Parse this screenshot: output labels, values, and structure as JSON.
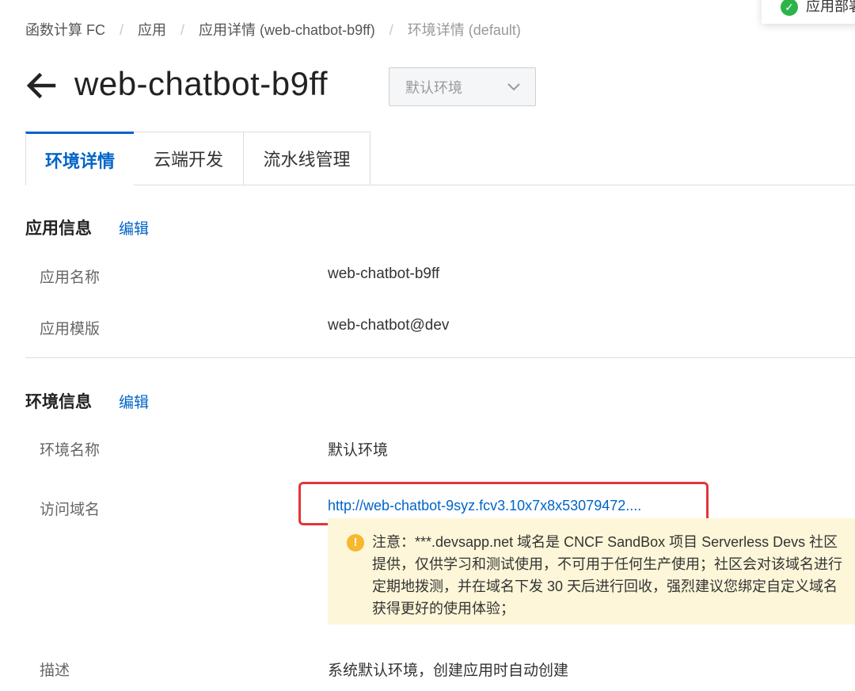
{
  "breadcrumb": {
    "items": [
      "函数计算 FC",
      "应用",
      "应用详情 (web-chatbot-b9ff)",
      "环境详情 (default)"
    ],
    "separator": "/"
  },
  "toast": {
    "text": "应用部署",
    "icon": "check-circle-icon"
  },
  "header": {
    "title": "web-chatbot-b9ff",
    "back_icon": "arrow-left-icon"
  },
  "env_select": {
    "value": "默认环境",
    "icon": "chevron-down-icon"
  },
  "tabs": [
    {
      "label": "环境详情",
      "active": true
    },
    {
      "label": "云端开发",
      "active": false
    },
    {
      "label": "流水线管理",
      "active": false
    }
  ],
  "app_info": {
    "title": "应用信息",
    "edit_label": "编辑",
    "rows": [
      {
        "label": "应用名称",
        "value": "web-chatbot-b9ff"
      },
      {
        "label": "应用模版",
        "value": "web-chatbot@dev"
      }
    ]
  },
  "env_info": {
    "title": "环境信息",
    "edit_label": "编辑",
    "name_label": "环境名称",
    "name_value": "默认环境",
    "domain_label": "访问域名",
    "domain_value": "http://web-chatbot-9syz.fcv3.10x7x8x53079472....",
    "desc_label": "描述",
    "desc_value": "系统默认环境，创建应用时自动创建"
  },
  "notice": {
    "icon": "exclamation-icon",
    "lines": [
      "注意：***.devsapp.net 域名是 CNCF SandBox 项目 Serverless Devs 社区",
      "提供，仅供学习和测试使用，不可用于任何生产使用；社区会对该域名进行",
      "定期地拨测，并在域名下发 30 天后进行回收，强烈建议您绑定自定义域名",
      "获得更好的使用体验；"
    ]
  },
  "colors": {
    "accent": "#0064c8",
    "highlight_box": "#e2353a",
    "notice_bg": "#fdf6d8",
    "success": "#2db34a"
  }
}
